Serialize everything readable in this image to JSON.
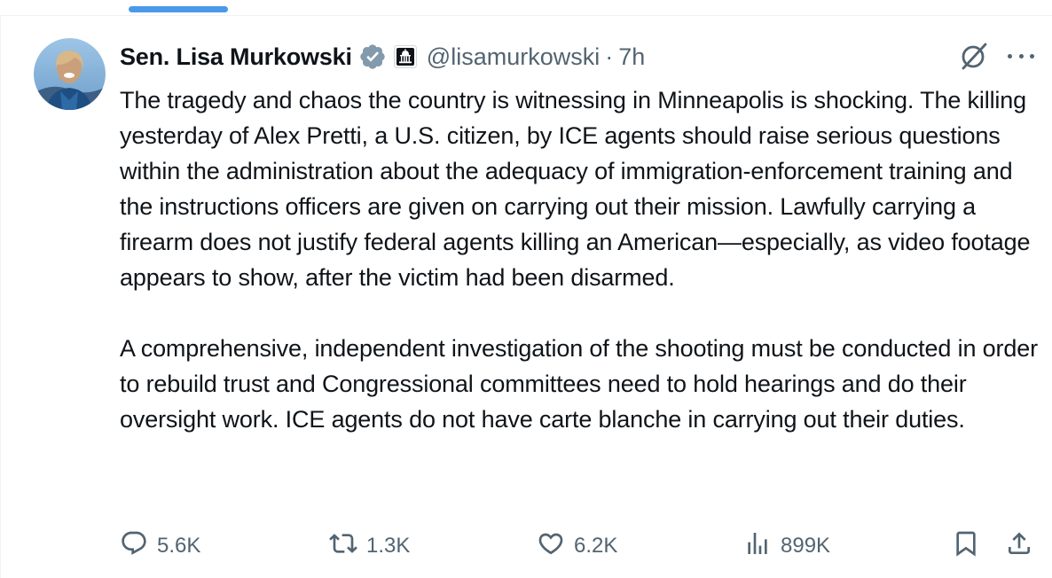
{
  "author": {
    "display_name": "Sen. Lisa Murkowski",
    "handle": "@lisamurkowski",
    "separator": "·",
    "time": "7h"
  },
  "icons": {
    "verified": "verified-badge-icon",
    "government": "capitol-building-icon",
    "grok": "grok-icon",
    "more": "more-icon",
    "reply": "reply-icon",
    "retweet": "retweet-icon",
    "like": "heart-icon",
    "views": "views-icon",
    "bookmark": "bookmark-icon",
    "share": "share-icon"
  },
  "tweet": {
    "paragraph_1": "The tragedy and chaos the country is witnessing in Minneapolis is shocking. The killing yesterday of Alex Pretti, a U.S. citizen, by ICE agents should raise serious questions within the administration about the adequacy of immigration-enforcement training and the instructions officers are given on carrying out their mission. Lawfully carrying a firearm does not justify federal agents killing an American—especially, as video footage appears to show, after the victim had been disarmed.",
    "paragraph_2": "A comprehensive, independent investigation of the shooting must be conducted in order to rebuild trust and Congressional committees need to hold hearings and do their oversight work. ICE agents do not have carte blanche in carrying out their duties."
  },
  "metrics": {
    "replies": "5.6K",
    "reposts": "1.3K",
    "likes": "6.2K",
    "views": "899K"
  },
  "colors": {
    "text": "#0f1419",
    "secondary": "#536471",
    "verified": "#829aab",
    "accent": "#4a99e9"
  }
}
